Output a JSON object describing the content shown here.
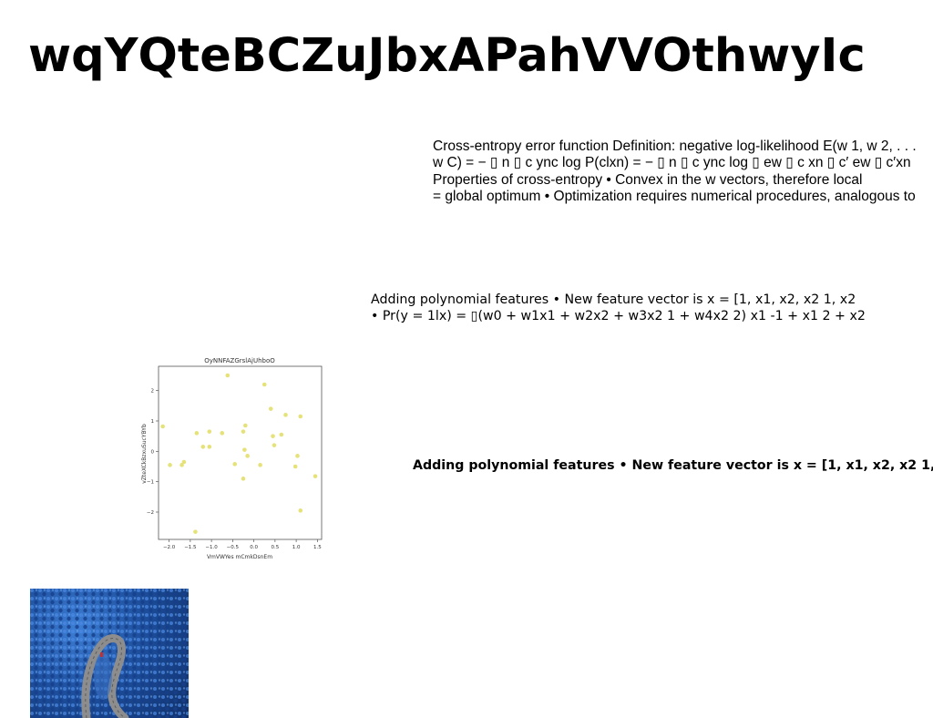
{
  "slide": {
    "title": "wqYQteBCZuJbxAPahVVOthwyIc"
  },
  "text_block_1": {
    "lines": [
      "Cross-entropy error function Definition: negative log-likelihood E(w 1, w 2, . . .",
      "w C) = − ▯ n ▯ c ync log P(clxn) = − ▯ n ▯ c ync log ▯ ew ▯ c xn ▯ c′ ew ▯ c′xn",
      "Properties of cross-entropy • Convex in the w vectors, therefore local",
      "= global optimum • Optimization requires numerical procedures, analogous to"
    ]
  },
  "text_block_2": {
    "lines": [
      "Adding polynomial features • New feature vector is x = [1, x1, x2, x2 1, x2",
      "• Pr(y = 1lx) = ▯(w0 + w1x1 + w2x2 + w3x2 1 + w4x2 2) x1 -1 + x1 2 + x2"
    ]
  },
  "text_block_3": {
    "line": "Adding polynomial features • New feature vector is x = [1, x1, x2, x2 1,"
  },
  "chart_data": {
    "type": "scatter",
    "title": "OyNNFAZGrslAjUhboO",
    "xlabel": "VmVWYes mCmkDsnEm",
    "ylabel": "vZteXCkBzxuSucYBYb",
    "xlim": [
      -2.25,
      1.6
    ],
    "ylim": [
      -2.9,
      2.8
    ],
    "xticks": [
      -2.0,
      -1.5,
      -1.0,
      -0.5,
      0.0,
      0.5,
      1.0,
      1.5
    ],
    "yticks": [
      -2,
      -1,
      0,
      1,
      2
    ],
    "xtick_labels": [
      "−2.0",
      "−1.5",
      "−1.0",
      "−0.5",
      "0.0",
      "0.5",
      "1.0",
      "1.5"
    ],
    "ytick_labels": [
      "−2",
      "−1",
      "0",
      "1",
      "2"
    ],
    "grid": false,
    "marker_color": "#e6e27a",
    "points": [
      {
        "x": -2.15,
        "y": 0.82
      },
      {
        "x": -1.98,
        "y": -0.45
      },
      {
        "x": -1.7,
        "y": -0.45
      },
      {
        "x": -1.65,
        "y": -0.35
      },
      {
        "x": -1.35,
        "y": 0.6
      },
      {
        "x": -1.38,
        "y": -2.65
      },
      {
        "x": -1.2,
        "y": 0.15
      },
      {
        "x": -1.05,
        "y": 0.15
      },
      {
        "x": -1.05,
        "y": 0.65
      },
      {
        "x": -0.75,
        "y": 0.6
      },
      {
        "x": -0.62,
        "y": 2.5
      },
      {
        "x": -0.45,
        "y": -0.42
      },
      {
        "x": -0.25,
        "y": 0.65
      },
      {
        "x": -0.2,
        "y": 0.85
      },
      {
        "x": -0.22,
        "y": 0.05
      },
      {
        "x": -0.15,
        "y": -0.15
      },
      {
        "x": -0.25,
        "y": -0.9
      },
      {
        "x": 0.15,
        "y": -0.45
      },
      {
        "x": 0.25,
        "y": 2.2
      },
      {
        "x": 0.4,
        "y": 1.4
      },
      {
        "x": 0.45,
        "y": 0.5
      },
      {
        "x": 0.48,
        "y": 0.2
      },
      {
        "x": 0.65,
        "y": 0.55
      },
      {
        "x": 0.75,
        "y": 1.2
      },
      {
        "x": 0.98,
        "y": -0.5
      },
      {
        "x": 1.03,
        "y": -0.15
      },
      {
        "x": 1.1,
        "y": 1.15
      },
      {
        "x": 1.1,
        "y": -1.95
      },
      {
        "x": 1.45,
        "y": -0.82
      }
    ]
  },
  "photo": {
    "description_icon": "landscape-photo-icon",
    "colors": {
      "foliage": "#2a63c4",
      "road": "#9a9a9a"
    }
  }
}
